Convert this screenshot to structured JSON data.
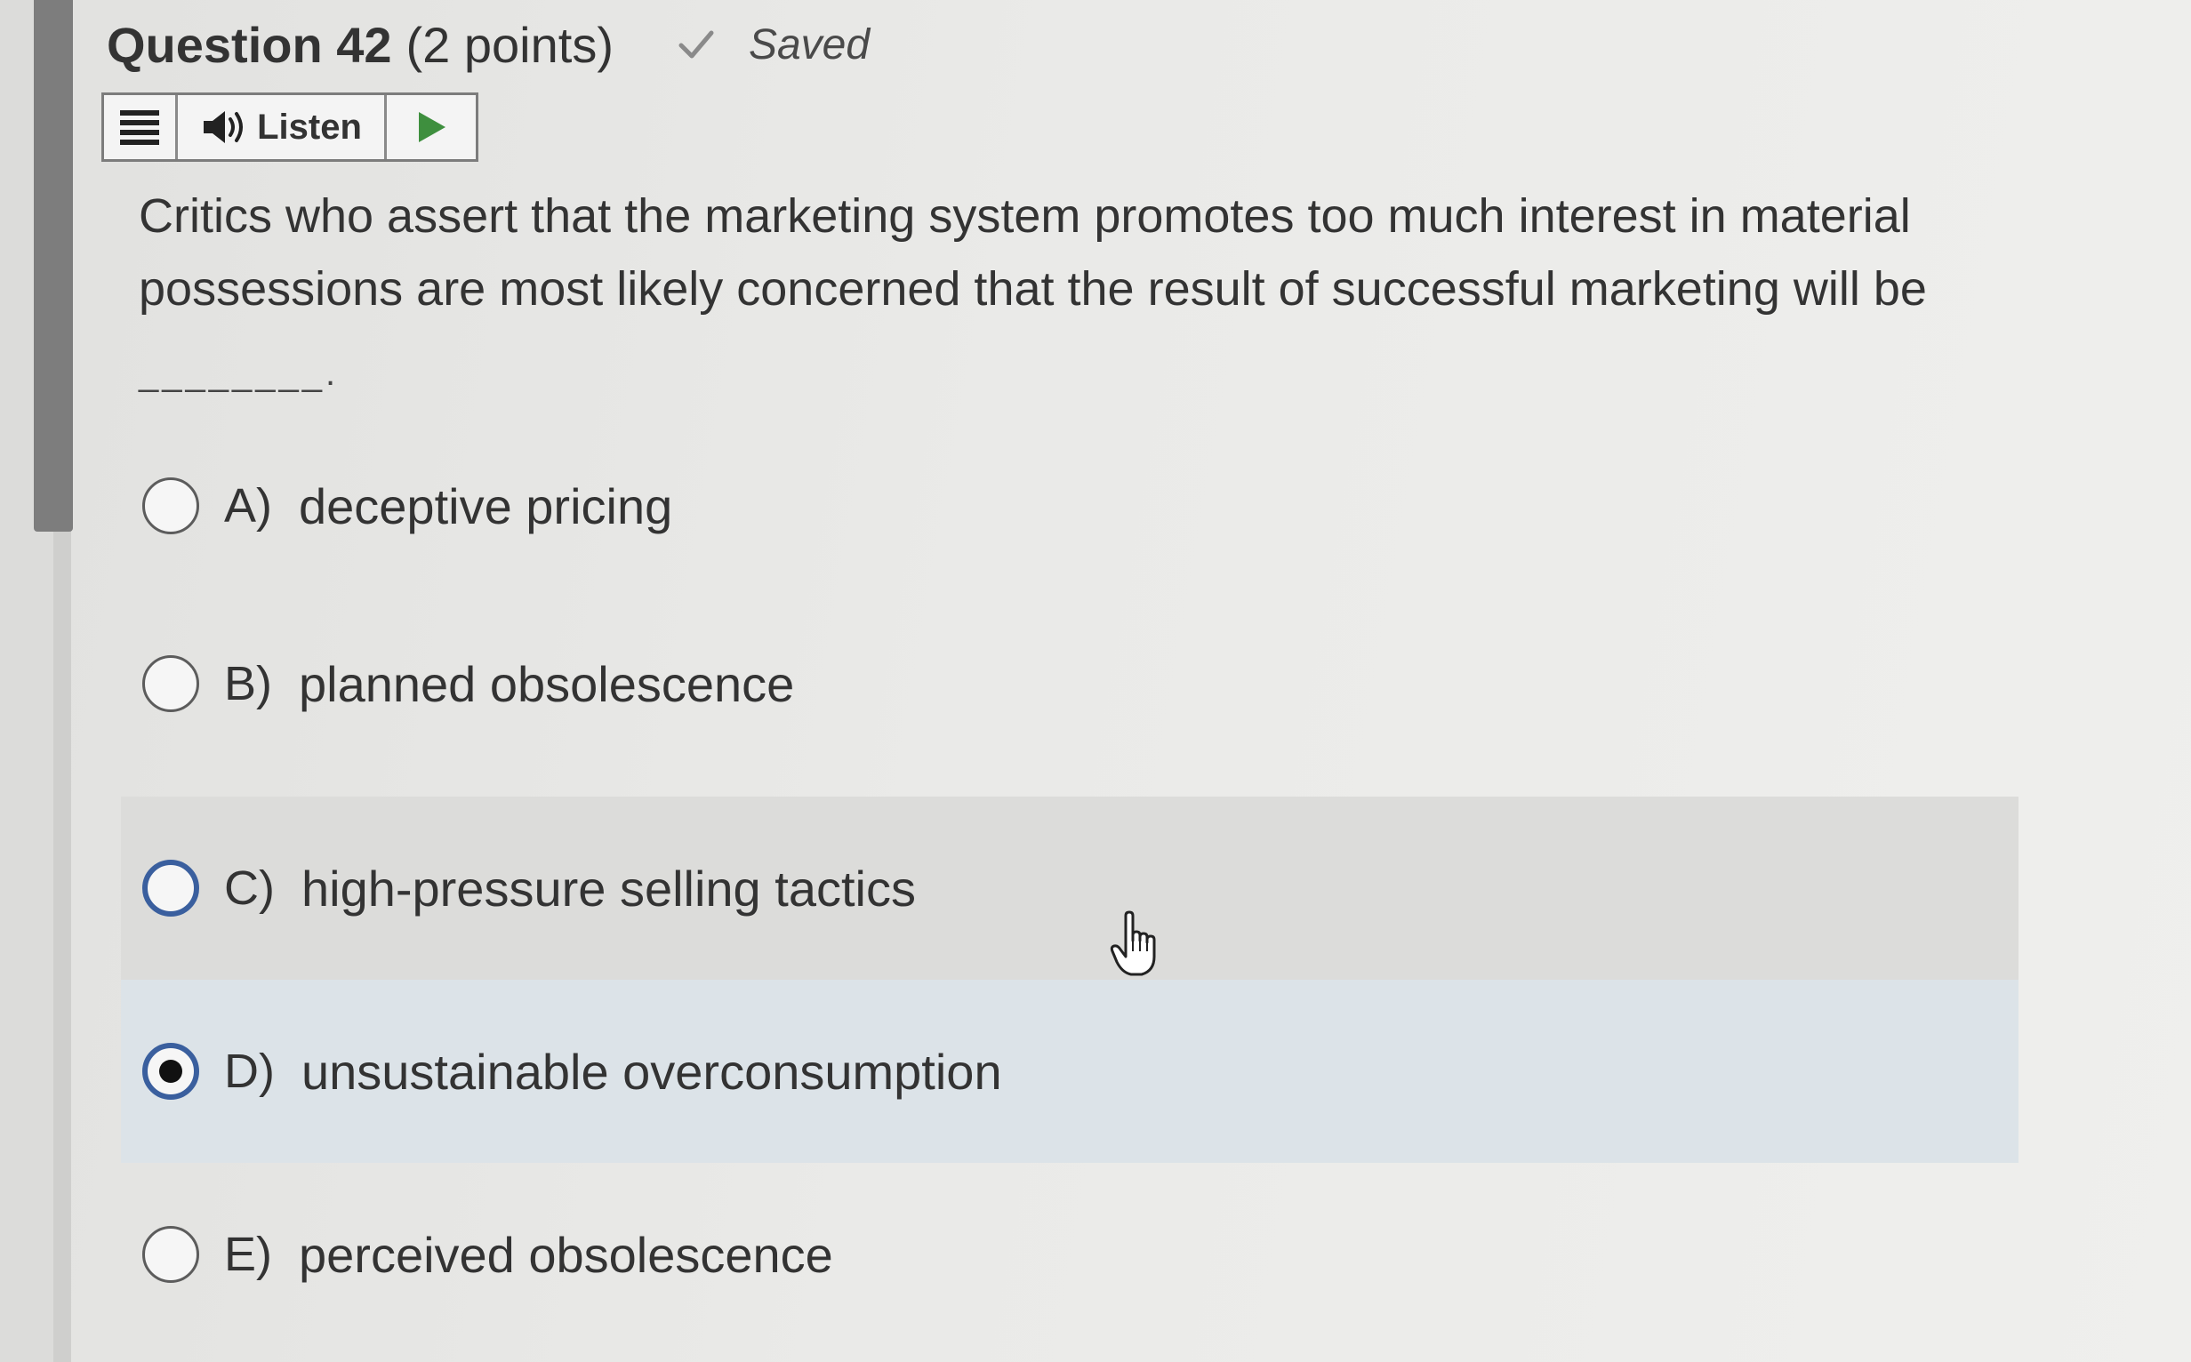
{
  "question": {
    "title": "Question 42",
    "points": "(2 points)",
    "saved_label": "Saved",
    "text": "Critics who assert that the marketing system promotes too much interest in material possessions are most likely concerned that the result of successful marketing will be",
    "blank": "________."
  },
  "toolbar": {
    "menu_icon": "hamburger-menu-icon",
    "speaker_icon": "speaker-icon",
    "listen_label": "Listen",
    "play_icon": "play-icon"
  },
  "options": [
    {
      "letter": "A)",
      "text": "deceptive pricing",
      "state": "unselected"
    },
    {
      "letter": "B)",
      "text": "planned obsolescence",
      "state": "unselected"
    },
    {
      "letter": "C)",
      "text": "high-pressure selling tactics",
      "state": "hover"
    },
    {
      "letter": "D)",
      "text": "unsustainable overconsumption",
      "state": "selected"
    },
    {
      "letter": "E)",
      "text": "perceived obsolescence",
      "state": "unselected"
    }
  ],
  "colors": {
    "accent": "#3a5f9e",
    "play_green": "#3e8f3e",
    "saved_check": "#8a8a8a",
    "selected_bg": "#dce3e8",
    "hover_bg": "#dcdcda"
  }
}
